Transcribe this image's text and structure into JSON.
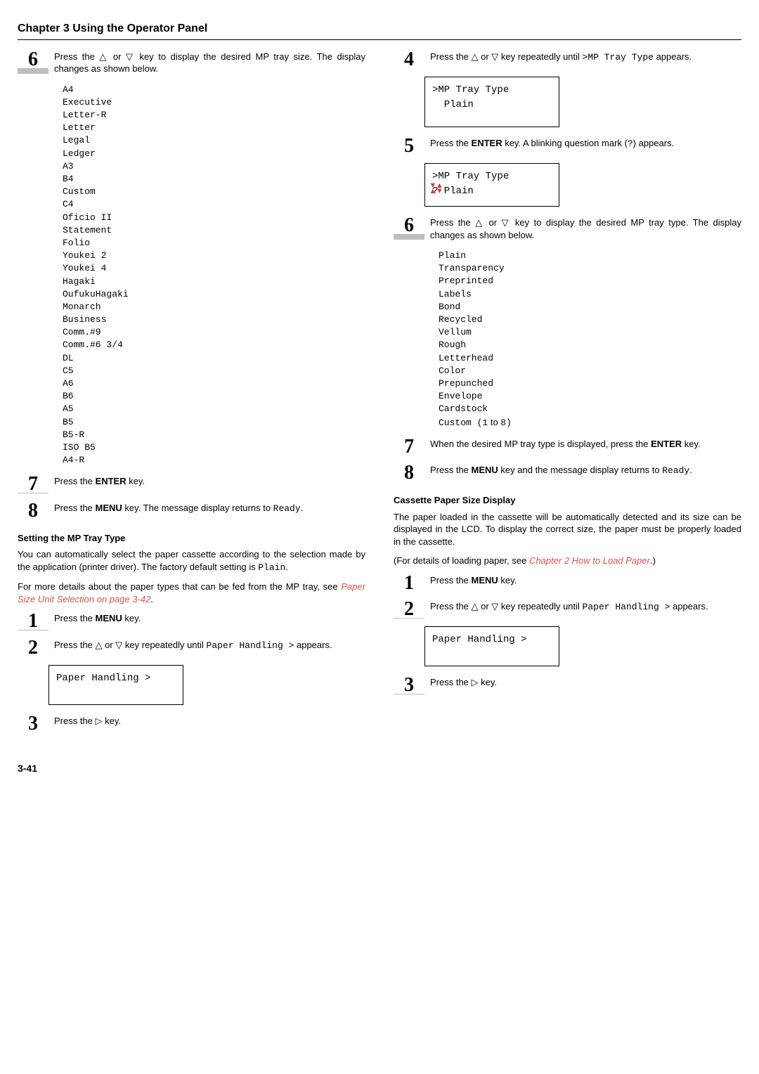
{
  "chapter_title": "Chapter 3  Using the Operator Panel",
  "left": {
    "step6": "Press the △ or ▽ key to display the desired MP tray size. The display changes as shown below.",
    "sizes": "A4\nExecutive\nLetter-R\nLetter\nLegal\nLedger\nA3\nB4\nCustom\nC4\nOficio II\nStatement\nFolio\nYoukei 2\nYoukei 4\nHagaki\nOufukuHagaki\nMonarch\nBusiness\nComm.#9\nComm.#6 3/4\nDL\nC5\nA6\nB6\nA5\nB5\nB5-R\nISO B5\nA4-R",
    "step7_pre": "Press the ",
    "step7_bold": "ENTER",
    "step7_post": " key.",
    "step8_pre": "Press the ",
    "step8_bold": "MENU",
    "step8_mid": " key. The message display returns to ",
    "step8_mono": "Ready",
    "step8_end": ".",
    "sub1": "Setting the MP Tray Type",
    "para1_a": "You can automatically select the paper cassette according to the selection made by the application (printer driver). The factory default setting is ",
    "para1_mono": "Plain",
    "para1_b": ".",
    "para2_a": "For more details about the paper types that can be fed from the MP tray, see ",
    "para2_link": "Paper Size Unit Selection on page 3-42",
    "para2_b": ".",
    "s1": "Press the ",
    "s1_bold": "MENU",
    "s1_post": " key.",
    "s2_a": "Press the △ or ▽ key repeatedly until ",
    "s2_mono": "Paper Handling >",
    "s2_b": " appears.",
    "lcd2": "Paper Handling >",
    "s3": "Press the ▷ key."
  },
  "right": {
    "s4_a": "Press the △ or ▽ key repeatedly until ",
    "s4_mono": ">MP Tray Type",
    "s4_b": " appears.",
    "lcd4_l1": ">MP Tray Type",
    "lcd4_l2": "  Plain",
    "s5_a": "Press the ",
    "s5_bold": "ENTER",
    "s5_b": " key. A blinking question mark (",
    "s5_mono": "?",
    "s5_c": ") appears.",
    "lcd5_l1": ">MP Tray Type",
    "lcd5_l2": "? Plain",
    "s6": "Press the △ or ▽ key to display the desired MP tray type. The display changes as shown below.",
    "types_a": "Plain\nTransparency\nPreprinted\nLabels\nBond\nRecycled\nVellum\nRough\nLetterhead\nColor\nPrepunched\nEnvelope\nCardstock",
    "types_last_a": "Custom (1",
    "types_last_mid": " to ",
    "types_last_b": "8)",
    "s7_a": "When the desired MP tray type is displayed, press the ",
    "s7_bold": "ENTER",
    "s7_b": " key.",
    "s8_a": "Press the ",
    "s8_bold": "MENU",
    "s8_b": " key and the message display returns to ",
    "s8_mono": "Ready",
    "s8_c": ".",
    "sub2": "Cassette Paper Size Display",
    "p2": "The paper loaded in the cassette will be automatically detected and its size can be displayed in the LCD. To display the correct size, the paper must be properly loaded in the cassette.",
    "p3_a": "(For details of loading paper, see ",
    "p3_link": "Chapter 2 How to Load Paper",
    "p3_b": ".)",
    "r1_a": "Press the ",
    "r1_bold": "MENU",
    "r1_b": " key.",
    "r2_a": "Press the △ or ▽ key repeatedly until ",
    "r2_mono": "Paper Handling >",
    "r2_b": " appears.",
    "rlcd": "Paper Handling >",
    "r3": "Press the ▷ key."
  },
  "page_num": "3-41"
}
